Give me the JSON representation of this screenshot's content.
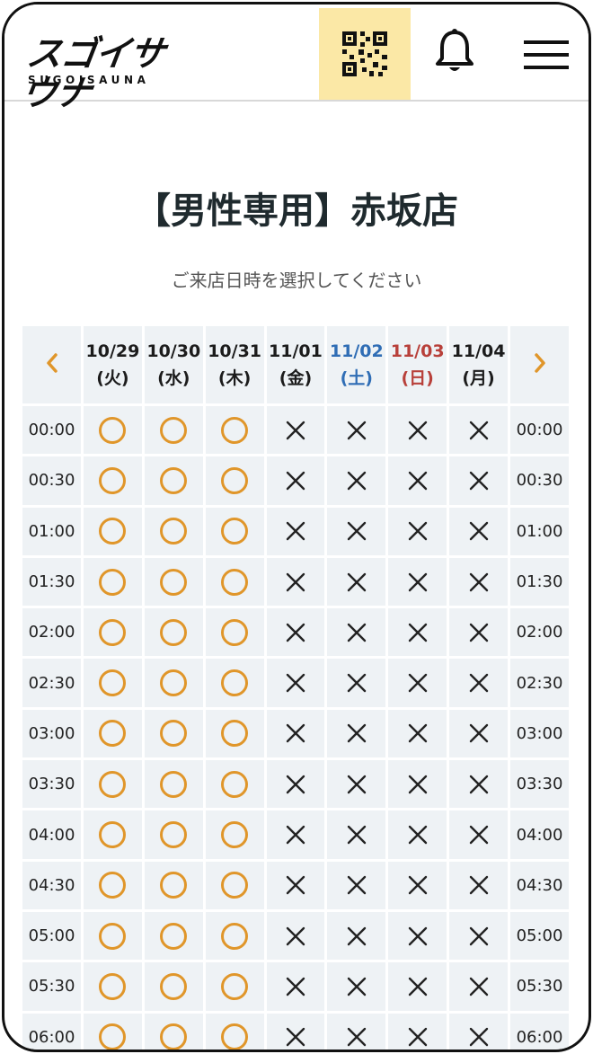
{
  "header": {
    "logo_main": "スゴイサウナ",
    "logo_sub": "SUGOISAUNA",
    "qr_bg": "#fbe8a6"
  },
  "page": {
    "title": "【男性専用】赤坂店",
    "subtitle": "ご来店日時を選択してください"
  },
  "calendar": {
    "prev_icon": "chevron-left-icon",
    "next_icon": "chevron-right-icon",
    "accent_color": "#e0962a",
    "saturday_color": "#2f6db5",
    "sunday_color": "#b8403a",
    "days": [
      {
        "md": "10/29",
        "dow": "(火)",
        "kind": "weekday"
      },
      {
        "md": "10/30",
        "dow": "(水)",
        "kind": "weekday"
      },
      {
        "md": "10/31",
        "dow": "(木)",
        "kind": "weekday"
      },
      {
        "md": "11/01",
        "dow": "(金)",
        "kind": "weekday"
      },
      {
        "md": "11/02",
        "dow": "(土)",
        "kind": "saturday"
      },
      {
        "md": "11/03",
        "dow": "(日)",
        "kind": "sunday"
      },
      {
        "md": "11/04",
        "dow": "(月)",
        "kind": "weekday"
      }
    ],
    "times": [
      "00:00",
      "00:30",
      "01:00",
      "01:30",
      "02:00",
      "02:30",
      "03:00",
      "03:30",
      "04:00",
      "04:30",
      "05:00",
      "05:30",
      "06:00"
    ],
    "availability": [
      "available",
      "available",
      "available",
      "unavailable",
      "unavailable",
      "unavailable",
      "unavailable"
    ]
  }
}
